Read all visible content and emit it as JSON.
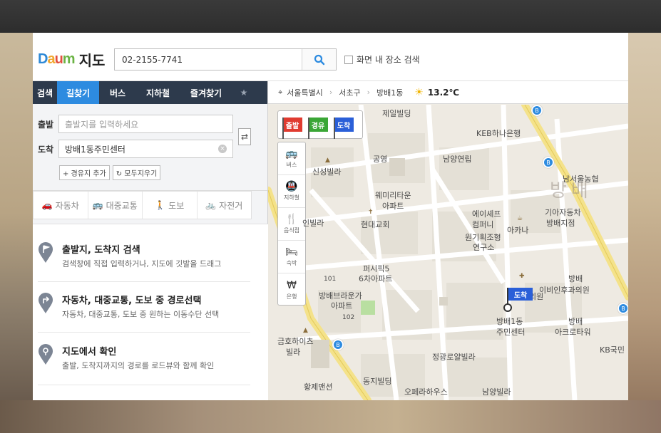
{
  "colors": {
    "brand_blue": "#2d8be0",
    "tab_bg": "#2d3a4c",
    "flag_start": "#e03b30",
    "flag_waypoint": "#3aa636",
    "flag_end": "#2a5fd8"
  },
  "header": {
    "logo_text": "Daum",
    "service_title": "지도",
    "search_value": "02-2155-7741",
    "search_icon": "search-icon",
    "in_area_label": "화면 내 장소 검색"
  },
  "tabs": [
    {
      "label": "검색"
    },
    {
      "label": "길찾기",
      "active": true
    },
    {
      "label": "버스"
    },
    {
      "label": "지하철"
    },
    {
      "label": "즐겨찾기"
    }
  ],
  "route": {
    "start_label": "출발",
    "start_placeholder": "출발지를 입력하세요",
    "end_label": "도착",
    "end_value": "방배1동주민센터",
    "add_waypoint": "+ 경유지 추가",
    "clear_all": "모두지우기",
    "modes": [
      "자동차",
      "대중교통",
      "도보",
      "자전거"
    ]
  },
  "guide": [
    {
      "title": "출발지, 도착지 검색",
      "desc": "검색창에 직접 입력하거나, 지도에 깃발을 드래그"
    },
    {
      "title": "자동차, 대중교통, 도보 중 경로선택",
      "desc": "자동차, 대중교통, 도보 중 원하는 이동수단 선택"
    },
    {
      "title": "지도에서 확인",
      "desc": "출발, 도착지까지의 경로를 로드뷰와 함께 확인"
    }
  ],
  "map_bar": {
    "city": "서울특별시",
    "district": "서초구",
    "dong": "방배1동",
    "temperature": "13.2℃"
  },
  "map_flags": [
    "출발",
    "경유",
    "도착"
  ],
  "map_tools": [
    "버스",
    "지하철",
    "음식점",
    "숙박",
    "은행"
  ],
  "map_labels": [
    "제일빌딩",
    "KEB하나은행",
    "남양연립",
    "공영",
    "신성빌라",
    "남서울농협",
    "방배",
    "웨미리타운",
    "아파트",
    "현대교회",
    "에이셰프",
    "컴퍼니",
    "아카나",
    "기아자동차",
    "방배지점",
    "원기획조형",
    "연구소",
    "퍼시픽5",
    "6차아파트",
    "방배",
    "이비인후과의원",
    "방배브라운가",
    "아파트",
    "101",
    "102",
    "방배1동",
    "주민센터",
    "방배",
    "아크로타워",
    "금호하이츠",
    "빌라",
    "정광로얄빌라",
    "KB국민",
    "동지빌딩",
    "황제맨션",
    "오페라하우스",
    "남양빌라",
    "도착",
    "제1",
    "의원",
    "인빌라"
  ]
}
